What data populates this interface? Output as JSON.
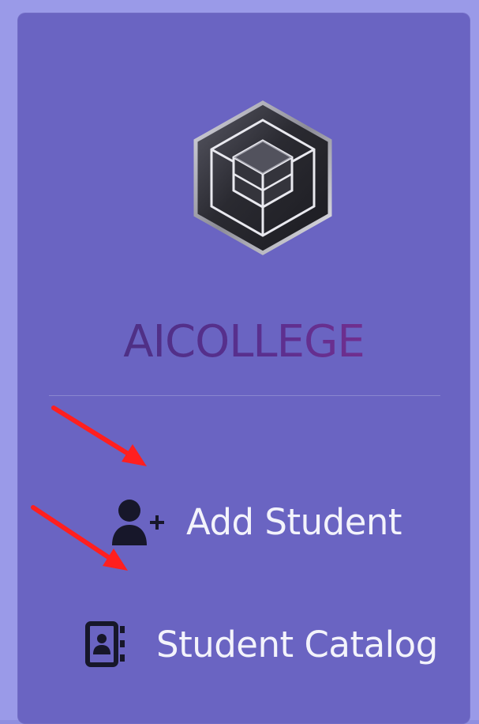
{
  "brand": {
    "name": "AICOLLEGE"
  },
  "nav": {
    "items": [
      {
        "label": "Add Student",
        "icon": "user-plus-icon"
      },
      {
        "label": "Student Catalog",
        "icon": "contact-book-icon"
      }
    ]
  },
  "colors": {
    "sidebar_bg": "#6a64c2",
    "frame_bg": "#9a9ae8",
    "nav_text": "#f3f3fb",
    "annotation_arrow": "#ff1f1f"
  }
}
